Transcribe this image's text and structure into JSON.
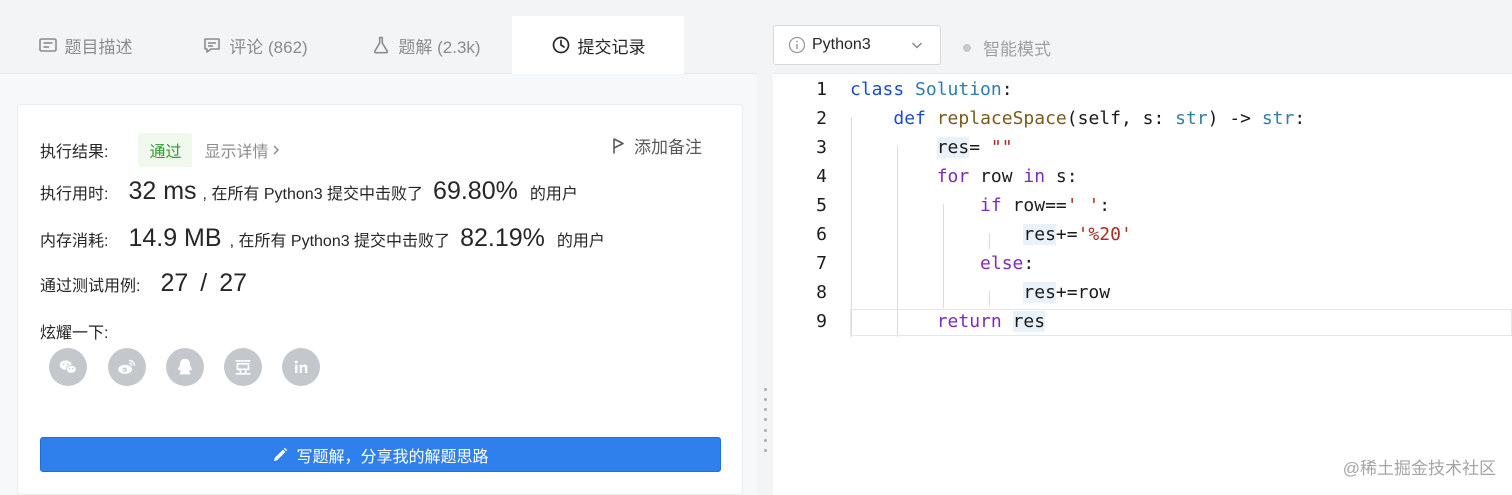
{
  "tabs": [
    {
      "label": "题目描述",
      "icon": "description-icon"
    },
    {
      "label": "评论 (862)",
      "icon": "comment-icon"
    },
    {
      "label": "题解 (2.3k)",
      "icon": "flask-icon"
    },
    {
      "label": "提交记录",
      "icon": "clock-icon",
      "active": true
    }
  ],
  "result": {
    "label": "执行结果:",
    "status": "通过",
    "details": "显示详情",
    "note": "添加备注"
  },
  "runtime": {
    "label": "执行用时:",
    "value": "32 ms",
    "mid": ", 在所有 Python3 提交中击败了",
    "percent": "69.80%",
    "suffix": "的用户"
  },
  "memory": {
    "label": "内存消耗:",
    "value": "14.9 MB",
    "mid": ", 在所有 Python3 提交中击败了",
    "percent": "82.19%",
    "suffix": "的用户"
  },
  "tests": {
    "label": "通过测试用例:",
    "passed": "27",
    "sep": "/",
    "total": "27"
  },
  "share": {
    "label": "炫耀一下:",
    "items": [
      "wechat-icon",
      "weibo-icon",
      "qq-icon",
      "douban-icon",
      "linkedin-icon"
    ]
  },
  "write_button": "写题解，分享我的解题思路",
  "editor": {
    "language": "Python3",
    "smart_mode": "智能模式",
    "line_numbers": [
      "1",
      "2",
      "3",
      "4",
      "5",
      "6",
      "7",
      "8",
      "9"
    ]
  },
  "watermark": "@稀土掘金技术社区",
  "colors": {
    "accent": "#2f80ed",
    "pass_green": "#2a9d32",
    "keyword": "#7c2bbd",
    "string": "#a82c1f"
  }
}
